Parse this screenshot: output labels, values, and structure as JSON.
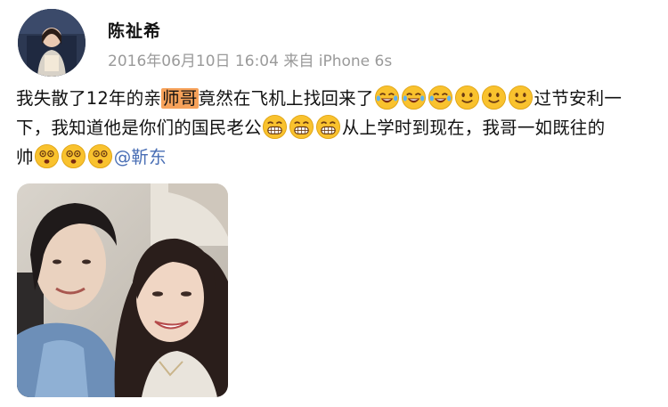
{
  "post": {
    "author": {
      "name": "陈祉希",
      "avatar_icon": "user-avatar"
    },
    "meta": {
      "timestamp": "2016年06月10日 16:04",
      "source_prefix": "来自",
      "source_device": "iPhone 6s"
    },
    "body": {
      "line1_pre": "我失散了12年的亲",
      "line1_highlight": "师哥",
      "line1_post": "竟然在飞机上找回来了",
      "line1_tail": "过节安利一",
      "line2_pre": "下，我知道他是你们的国民老公",
      "line2_post": "从上学时到现在，我哥一如既往的",
      "line3_pre": "帅",
      "mention": "@靳东"
    },
    "emojis": {
      "laugh_cry": "laugh-cry-emoji",
      "smile": "smile-emoji",
      "grin": "grin-emoji",
      "dizzy": "dizzy-face-emoji"
    },
    "photo": {
      "subject": "selfie-photo"
    },
    "colors": {
      "highlight": "#f7a25a",
      "mention": "#4a6fb5",
      "meta": "#9a9a9a",
      "emoji_yellow": "#f9c22e"
    }
  }
}
